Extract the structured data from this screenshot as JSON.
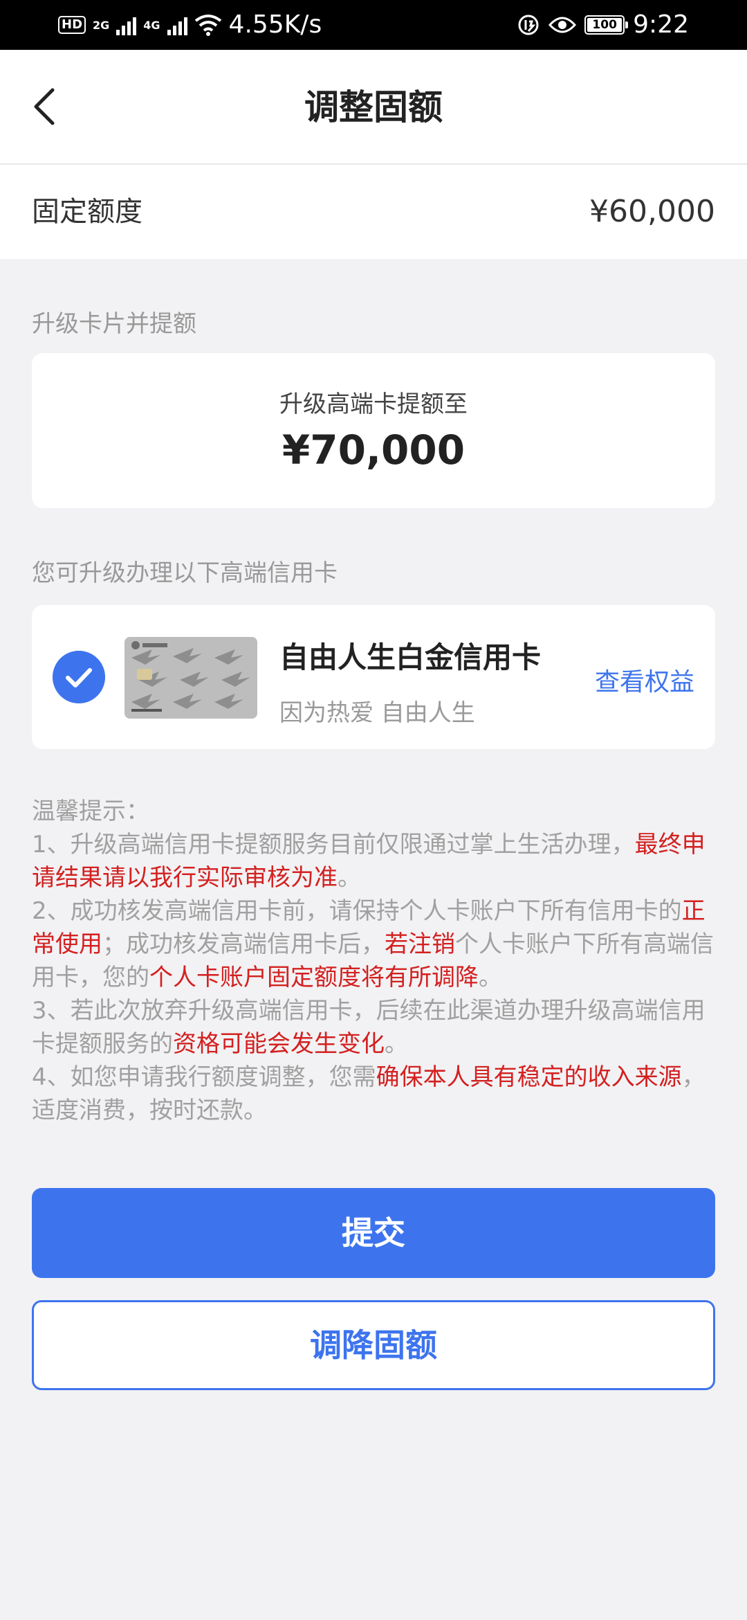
{
  "status_bar": {
    "hd": "HD",
    "sim1_net": "2G",
    "sim2_net": "4G",
    "speed": "4.55K/s",
    "battery": "100",
    "time": "9:22"
  },
  "header": {
    "title": "调整固额"
  },
  "fixed_quota": {
    "label": "固定额度",
    "value": "¥60,000"
  },
  "upgrade_section": {
    "label": "升级卡片并提额",
    "subtitle": "升级高端卡提额至",
    "amount": "¥70,000"
  },
  "card_section": {
    "label": "您可升级办理以下高端信用卡",
    "card_name": "自由人生白金信用卡",
    "card_slogan": "因为热爱 自由人生",
    "benefits_link": "查看权益",
    "selected": true
  },
  "tips": {
    "title": "温馨提示：",
    "items": [
      [
        {
          "text": "1、升级高端信用卡提额服务目前仅限通过掌上生活办理，",
          "hl": false
        },
        {
          "text": "最终申请结果请以我行实际审核为准",
          "hl": true
        },
        {
          "text": "。",
          "hl": false
        }
      ],
      [
        {
          "text": "2、成功核发高端信用卡前，请保持个人卡账户下所有信用卡的",
          "hl": false
        },
        {
          "text": "正常使用",
          "hl": true
        },
        {
          "text": "；成功核发高端信用卡后，",
          "hl": false
        },
        {
          "text": "若注销",
          "hl": true
        },
        {
          "text": "个人卡账户下所有高端信用卡，您的",
          "hl": false
        },
        {
          "text": "个人卡账户固定额度将有所调降",
          "hl": true
        },
        {
          "text": "。",
          "hl": false
        }
      ],
      [
        {
          "text": "3、若此次放弃升级高端信用卡，后续在此渠道办理升级高端信用卡提额服务的",
          "hl": false
        },
        {
          "text": "资格可能会发生变化",
          "hl": true
        },
        {
          "text": "。",
          "hl": false
        }
      ],
      [
        {
          "text": "4、如您申请我行额度调整，您需",
          "hl": false
        },
        {
          "text": "确保本人具有稳定的收入来源",
          "hl": true
        },
        {
          "text": "，适度消费，按时还款。",
          "hl": false
        }
      ]
    ]
  },
  "buttons": {
    "submit": "提交",
    "lower": "调降固额"
  },
  "colors": {
    "accent": "#3d74ee",
    "highlight": "#d42020",
    "muted": "#a0a0a0",
    "background": "#f2f2f4"
  },
  "icons": {
    "back": "chevron-left-icon",
    "check": "check-circle-icon",
    "wifi": "wifi-icon",
    "eye": "eye-icon"
  }
}
